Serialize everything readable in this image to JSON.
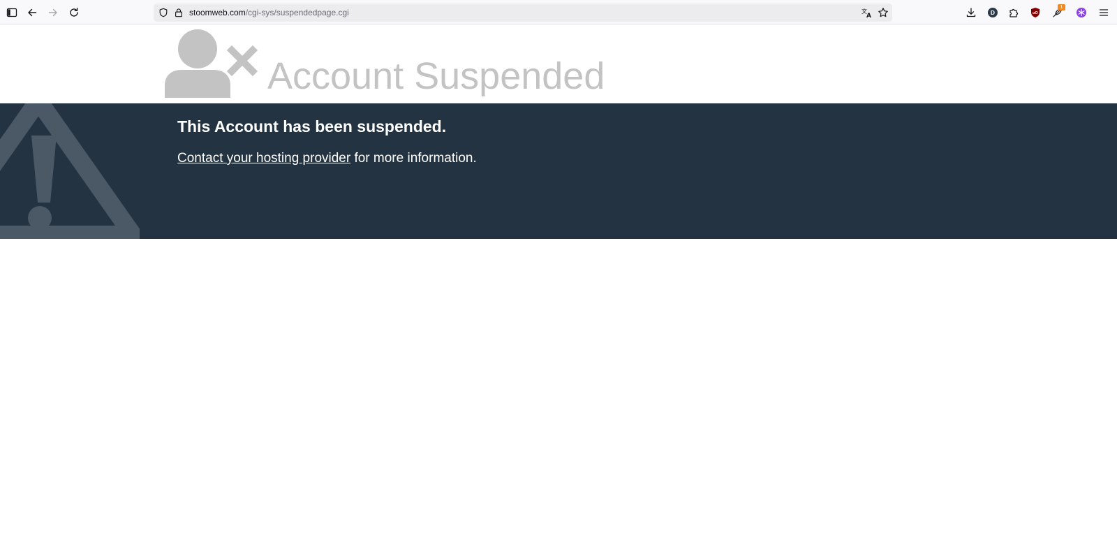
{
  "browser": {
    "url_host": "stoomweb.com",
    "url_path": "/cgi-sys/suspendedpage.cgi",
    "extension_badge": "1",
    "profile_initial": "D",
    "icons": {
      "sidebar": "sidebar-icon",
      "back": "back-arrow-icon",
      "forward": "forward-arrow-icon",
      "reload": "reload-icon",
      "tracking_protection": "shield-icon",
      "lock": "lock-icon",
      "translate": "translate-icon",
      "bookmark": "star-icon",
      "downloads": "download-icon",
      "extensions": "puzzle-icon",
      "ublock": "ublock-shield-icon",
      "menu": "hamburger-menu-icon"
    }
  },
  "page": {
    "title": "Account Suspended",
    "heading": "This Account has been suspended.",
    "contact_link": "Contact your hosting provider",
    "contact_suffix": " for more information.",
    "colors": {
      "band_background": "#233341",
      "title_gray": "#c3c3c3",
      "icon_gray": "#c3c3c3",
      "warning_watermark": "#4b5967"
    },
    "icons": {
      "header": "user-x-icon",
      "watermark": "warning-triangle-icon"
    }
  }
}
